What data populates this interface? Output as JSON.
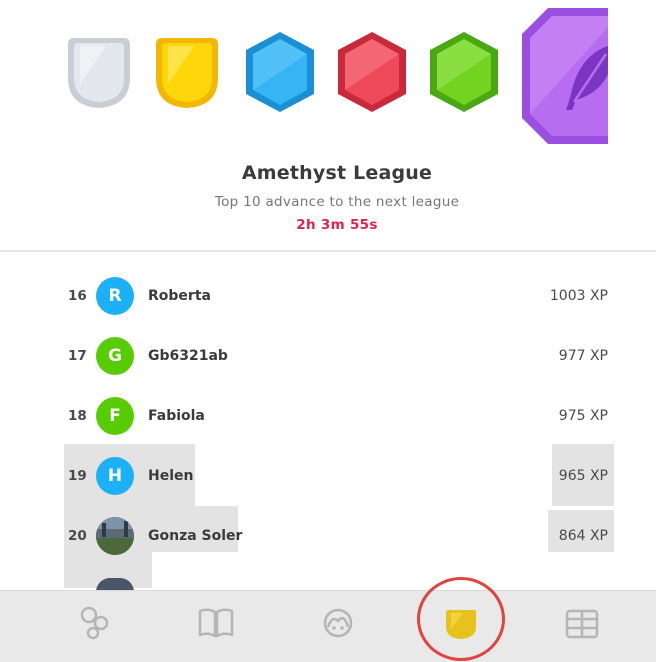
{
  "league": {
    "title": "Amethyst League",
    "subtitle": "Top 10 advance to the next league",
    "countdown": "2h 3m 55s"
  },
  "badges": [
    {
      "name": "silver-league-badge",
      "color": "#d9dde3"
    },
    {
      "name": "gold-league-badge",
      "color": "#ffd400"
    },
    {
      "name": "sapphire-league-badge",
      "color": "#2fb4f0"
    },
    {
      "name": "ruby-league-badge",
      "color": "#ef4a5a"
    },
    {
      "name": "emerald-league-badge",
      "color": "#6fd31e"
    },
    {
      "name": "amethyst-league-badge",
      "color": "#b86cf0",
      "icon": "feather-icon"
    }
  ],
  "leaderboard": [
    {
      "rank": "16",
      "initial": "R",
      "name": "Roberta",
      "xp": "1003 XP",
      "color": "#1cb0f6"
    },
    {
      "rank": "17",
      "initial": "G",
      "name": "Gb6321ab",
      "xp": "977 XP",
      "color": "#58cc02"
    },
    {
      "rank": "18",
      "initial": "F",
      "name": "Fabiola",
      "xp": "975 XP",
      "color": "#58cc02"
    },
    {
      "rank": "19",
      "initial": "H",
      "name": "Helen",
      "xp": "965 XP",
      "color": "#1cb0f6"
    },
    {
      "rank": "20",
      "initial": "",
      "name": "Gonza Soler",
      "xp": "864 XP",
      "avatar": "photo"
    }
  ],
  "tabs": [
    {
      "name": "learn-tab",
      "icon": "bubbles-icon"
    },
    {
      "name": "stories-tab",
      "icon": "book-icon"
    },
    {
      "name": "profile-tab",
      "icon": "avatar-icon"
    },
    {
      "name": "leaderboards-tab",
      "icon": "shield-icon",
      "active": true
    },
    {
      "name": "shop-tab",
      "icon": "shop-icon"
    }
  ],
  "colors": {
    "timer": "#e0234a",
    "active_tab": "#e6c21c",
    "annotation_ring": "#e0443e"
  }
}
